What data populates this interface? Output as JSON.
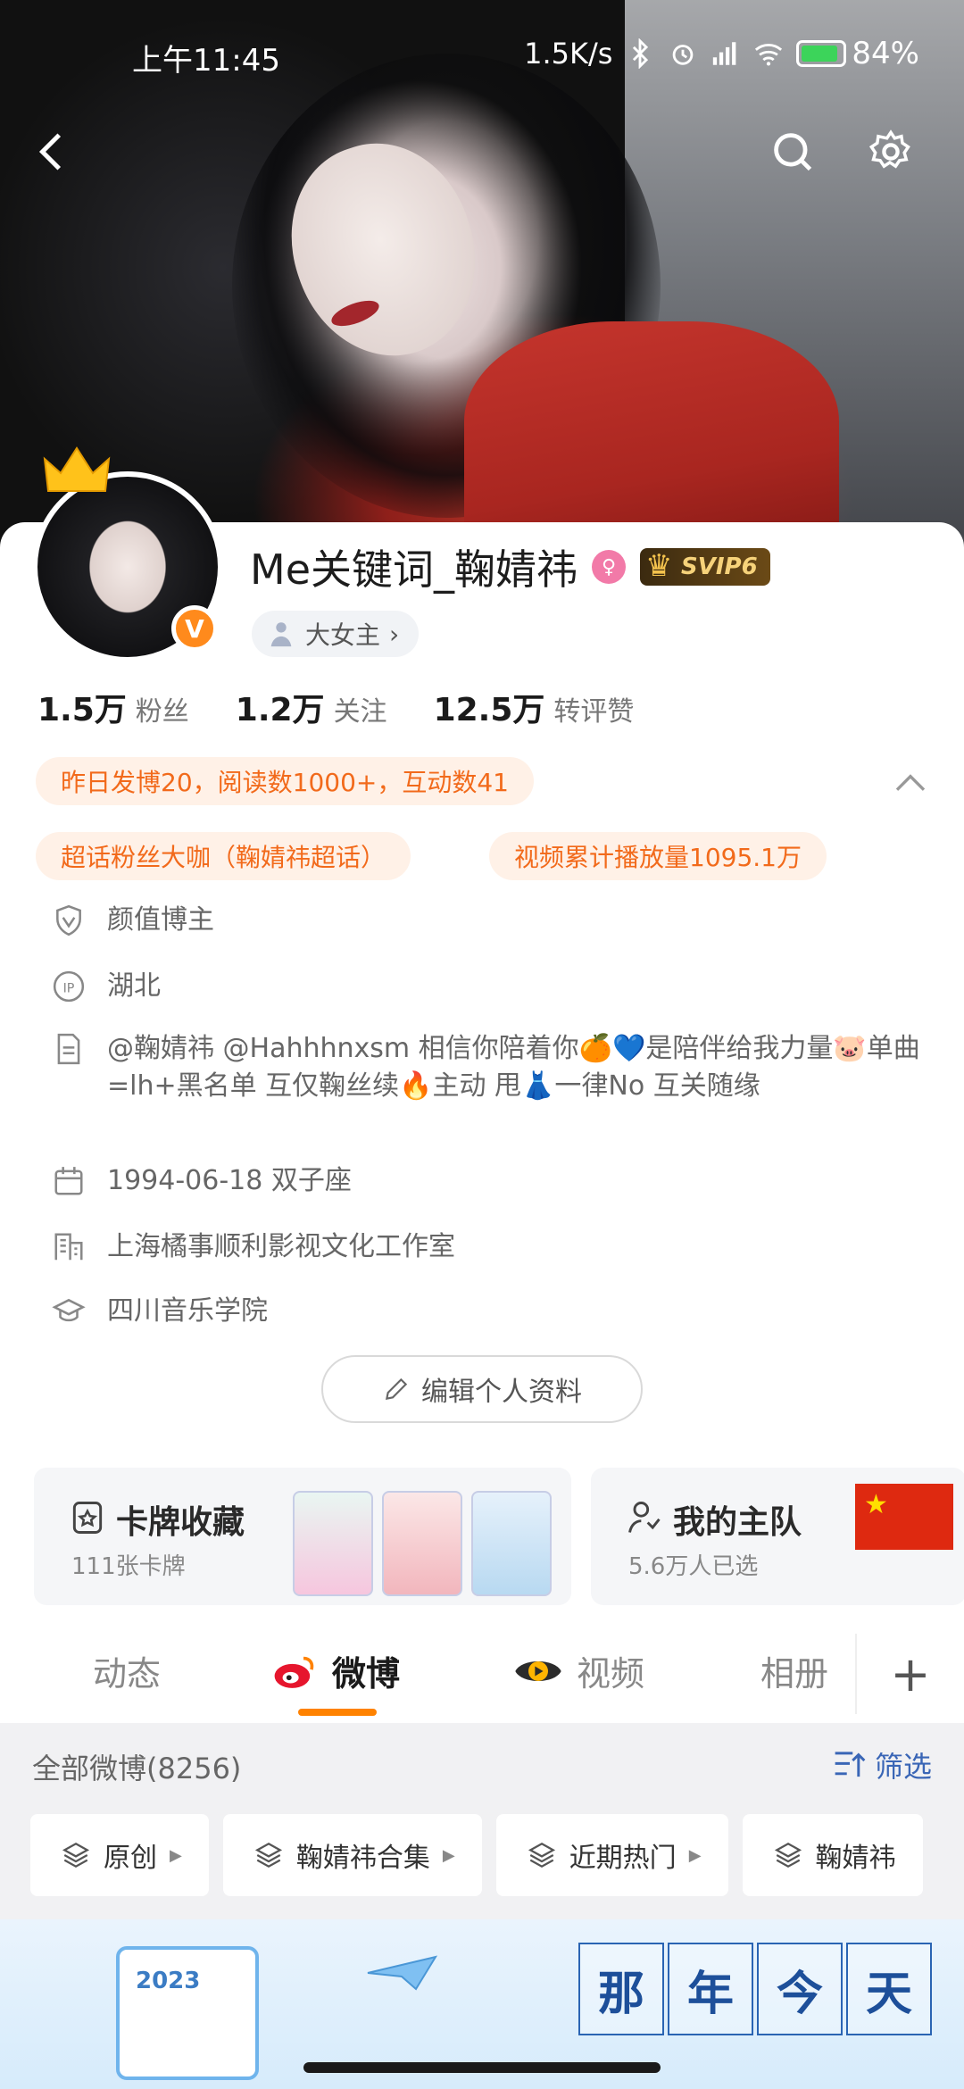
{
  "status_bar": {
    "time": "上午11:45",
    "network_speed": "1.5K/s",
    "battery": "84%"
  },
  "profile": {
    "username": "Me关键词_鞠婧祎",
    "vip_badge": "SVIP6",
    "tag": "大女主",
    "stats": [
      {
        "num": "1.5万",
        "label": "粉丝"
      },
      {
        "num": "1.2万",
        "label": "关注"
      },
      {
        "num": "12.5万",
        "label": "转评赞"
      }
    ],
    "activity_chip": "昨日发博20，阅读数1000+，互动数41",
    "honor_chips": [
      "超话粉丝大咖（鞠婧祎超话）",
      "视频累计播放量1095.1万"
    ],
    "info": {
      "category": "颜值博主",
      "ip": "湖北",
      "bio": "@鞠婧祎 @Hahhhnxsm 相信你陪着你🍊💙是陪伴给我力量🐷单曲=lh+黑名单 互仅鞠丝续🔥主动 甩👗一律No 互关随缘",
      "birthday": "1994-06-18 双子座",
      "company": "上海橘事顺利影视文化工作室",
      "school": "四川音乐学院"
    },
    "edit_label": "编辑个人资料"
  },
  "cards": {
    "collection_title": "卡牌收藏",
    "collection_sub": "111张卡牌",
    "team_title": "我的主队",
    "team_sub": "5.6万人已选"
  },
  "tabs": [
    "动态",
    "微博",
    "视频",
    "相册"
  ],
  "tab_add": "+",
  "feed": {
    "header": "全部微博(8256)",
    "filter_label": "筛选",
    "chips": [
      "原创",
      "鞠婧祎合集",
      "近期热门",
      "鞠婧祎"
    ]
  },
  "banner": {
    "year": "2023",
    "title_chars": [
      "那",
      "年",
      "今",
      "天"
    ]
  },
  "colors": {
    "accent_orange": "#ff8200",
    "chip_orange_text": "#f26a1b",
    "link_blue": "#3a66b6"
  }
}
